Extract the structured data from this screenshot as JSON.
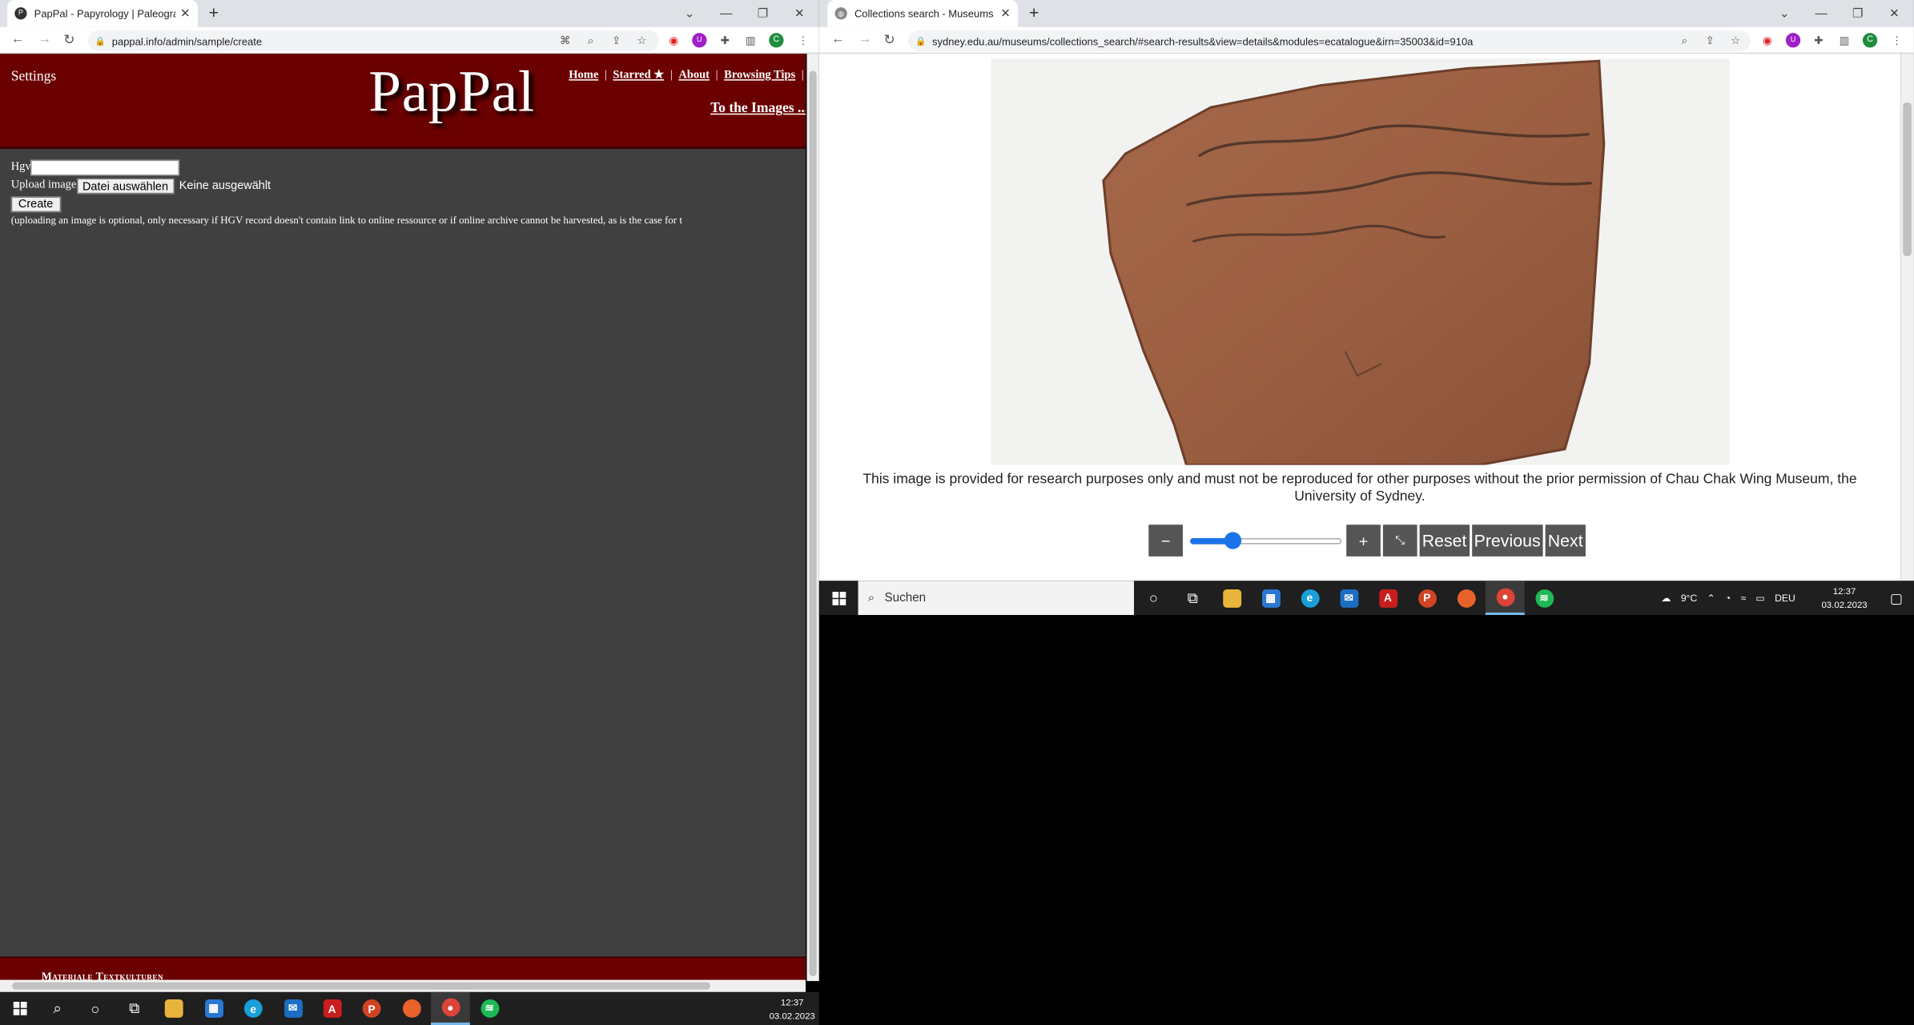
{
  "left_window": {
    "tab": {
      "title": "PapPal - Papyrology | Paleograph",
      "close": "✕"
    },
    "new_tab": "+",
    "window_controls": [
      "⌄",
      "—",
      "❐",
      "✕"
    ],
    "url": "pappal.info/admin/sample/create",
    "page": {
      "settings": "Settings",
      "logo": "PapPal",
      "nav": [
        "Home",
        "Starred ★",
        "About",
        "Browsing Tips",
        "("
      ],
      "images_link": "To the Images ...",
      "hgv_label": "Hgv",
      "upload_label": "Upload image",
      "file_button": "Datei auswählen",
      "file_status": "Keine ausgewählt",
      "create_button": "Create",
      "note": "(uploading an image is optional, only necessary if HGV record doesn't contain link to online ressource or if online archive cannot be harvested, as is the case for t",
      "footer": "Materiale Textkulturen"
    }
  },
  "right_window": {
    "tab": {
      "title": "Collections search - Museums - T",
      "close": "✕"
    },
    "new_tab": "+",
    "window_controls": [
      "⌄",
      "—",
      "❐",
      "✕"
    ],
    "url": "sydney.edu.au/museums/collections_search/#search-results&view=details&modules=ecatalogue&irn=35003&id=910a",
    "page": {
      "rights_text": "This image is provided for research purposes only and must not be reproduced for other purposes without the prior permission of Chau Chak Wing Museum, the University of Sydney.",
      "zoom_out": "−",
      "zoom_in": "+",
      "fullscreen": "⤡",
      "reset": "Reset",
      "previous": "Previous",
      "next": "Next",
      "zoom_level": 0.28
    }
  },
  "right_taskbar": {
    "search_placeholder": "Suchen",
    "weather": "9°C",
    "language": "DEU",
    "time": "12:37",
    "date": "03.02.2023"
  },
  "bottom_taskbar": {
    "time": "12:37",
    "date": "03.02.2023"
  },
  "colors": {
    "pappal_red": "#6b0000",
    "page_gray": "#404040",
    "slider_blue": "#1a73e8",
    "viewer_button": "#555555"
  }
}
